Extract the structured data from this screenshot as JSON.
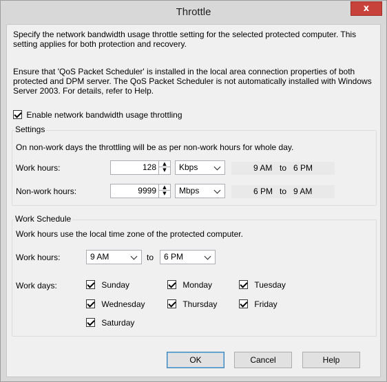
{
  "window": {
    "title": "Throttle",
    "close_glyph": "x"
  },
  "intro": {
    "line1": "Specify the network bandwidth usage throttle setting for the selected protected computer. This setting applies for both protection and recovery.",
    "line2": "Ensure that 'QoS Packet Scheduler' is installed in the local area connection properties of both protected and DPM server. The QoS Packet Scheduler is not automatically installed with Windows Server 2003. For details, refer to Help."
  },
  "enable_throttling": {
    "label": "Enable network bandwidth usage throttling",
    "checked": true
  },
  "settings": {
    "legend": "Settings",
    "note": "On non-work days the throttling will be as per non-work hours for whole day.",
    "work": {
      "label": "Work hours:",
      "value": "128",
      "unit": "Kbps",
      "from": "9 AM",
      "to_word": "to",
      "to": "6 PM"
    },
    "nonwork": {
      "label": "Non-work hours:",
      "value": "9999",
      "unit": "Mbps",
      "from": "6 PM",
      "to_word": "to",
      "to": "9 AM"
    }
  },
  "schedule": {
    "legend": "Work Schedule",
    "note": "Work hours use the local time zone of the protected computer.",
    "hours_label": "Work hours:",
    "start": "9 AM",
    "to_word": "to",
    "end": "6 PM",
    "days_label": "Work days:",
    "days": [
      {
        "label": "Sunday",
        "checked": true
      },
      {
        "label": "Monday",
        "checked": true
      },
      {
        "label": "Tuesday",
        "checked": true
      },
      {
        "label": "Wednesday",
        "checked": true
      },
      {
        "label": "Thursday",
        "checked": true
      },
      {
        "label": "Friday",
        "checked": true
      },
      {
        "label": "Saturday",
        "checked": true
      }
    ]
  },
  "buttons": {
    "ok": "OK",
    "cancel": "Cancel",
    "help": "Help"
  },
  "icons": {
    "spin_up": "▲",
    "spin_down": "▼"
  },
  "colors": {
    "close": "#c7423a",
    "default_border": "#3c7fb1"
  }
}
